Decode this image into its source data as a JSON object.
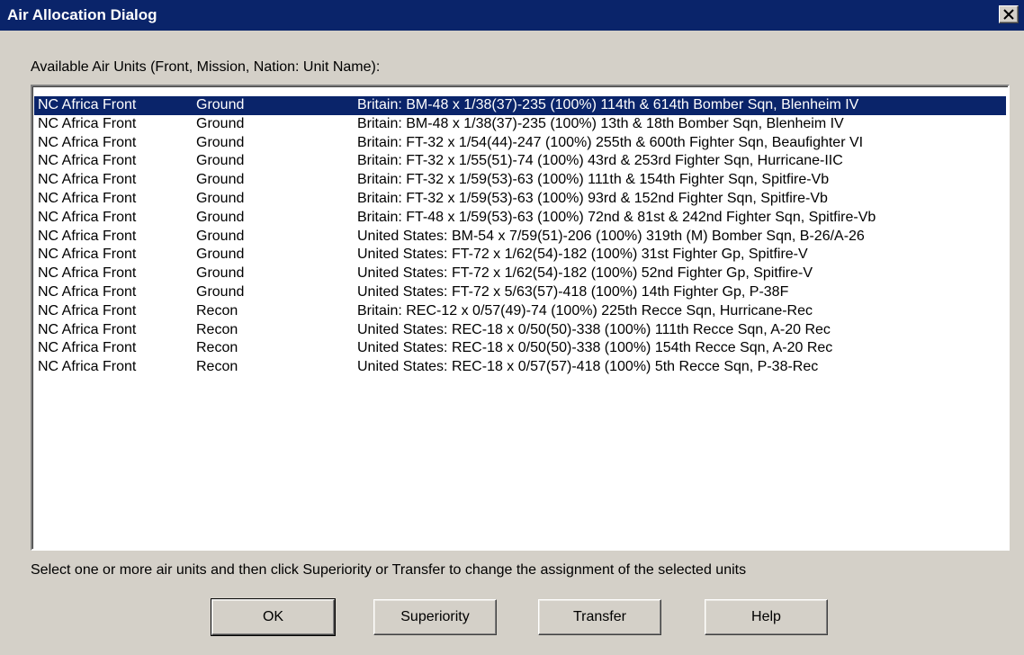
{
  "window": {
    "title": "Air Allocation Dialog"
  },
  "list": {
    "label": "Available Air Units (Front, Mission, Nation: Unit Name):",
    "selected_index": 0,
    "rows": [
      {
        "front": "NC Africa Front",
        "mission": "Ground",
        "unit": "Britain: BM-48 x 1/38(37)-235 (100%) 114th & 614th Bomber Sqn, Blenheim IV"
      },
      {
        "front": "NC Africa Front",
        "mission": "Ground",
        "unit": "Britain: BM-48 x 1/38(37)-235 (100%) 13th & 18th Bomber Sqn, Blenheim IV"
      },
      {
        "front": "NC Africa Front",
        "mission": "Ground",
        "unit": "Britain: FT-32 x 1/54(44)-247 (100%) 255th & 600th Fighter Sqn, Beaufighter VI"
      },
      {
        "front": "NC Africa Front",
        "mission": "Ground",
        "unit": "Britain: FT-32 x 1/55(51)-74 (100%) 43rd & 253rd Fighter Sqn, Hurricane-IIC"
      },
      {
        "front": "NC Africa Front",
        "mission": "Ground",
        "unit": "Britain: FT-32 x 1/59(53)-63 (100%) 111th & 154th Fighter Sqn, Spitfire-Vb"
      },
      {
        "front": "NC Africa Front",
        "mission": "Ground",
        "unit": "Britain: FT-32 x 1/59(53)-63 (100%) 93rd & 152nd Fighter Sqn, Spitfire-Vb"
      },
      {
        "front": "NC Africa Front",
        "mission": "Ground",
        "unit": "Britain: FT-48 x 1/59(53)-63 (100%) 72nd & 81st & 242nd Fighter Sqn, Spitfire-Vb"
      },
      {
        "front": "NC Africa Front",
        "mission": "Ground",
        "unit": "United States: BM-54 x 7/59(51)-206 (100%) 319th (M) Bomber Sqn, B-26/A-26"
      },
      {
        "front": "NC Africa Front",
        "mission": "Ground",
        "unit": "United States: FT-72 x 1/62(54)-182 (100%) 31st Fighter Gp, Spitfire-V"
      },
      {
        "front": "NC Africa Front",
        "mission": "Ground",
        "unit": "United States: FT-72 x 1/62(54)-182 (100%) 52nd Fighter Gp, Spitfire-V"
      },
      {
        "front": "NC Africa Front",
        "mission": "Ground",
        "unit": "United States: FT-72 x 5/63(57)-418 (100%) 14th Fighter Gp, P-38F"
      },
      {
        "front": "NC Africa Front",
        "mission": "Recon",
        "unit": "Britain: REC-12 x 0/57(49)-74 (100%) 225th Recce Sqn, Hurricane-Rec"
      },
      {
        "front": "NC Africa Front",
        "mission": "Recon",
        "unit": "United States: REC-18 x 0/50(50)-338 (100%) 111th Recce Sqn, A-20 Rec"
      },
      {
        "front": "NC Africa Front",
        "mission": "Recon",
        "unit": "United States: REC-18 x 0/50(50)-338 (100%) 154th Recce Sqn, A-20 Rec"
      },
      {
        "front": "NC Africa Front",
        "mission": "Recon",
        "unit": "United States: REC-18 x 0/57(57)-418 (100%) 5th Recce Sqn, P-38-Rec"
      }
    ]
  },
  "hint": "Select one or more air units and then click Superiority or Transfer to change the assignment of the selected units",
  "buttons": {
    "ok": "OK",
    "superiority": "Superiority",
    "transfer": "Transfer",
    "help": "Help"
  },
  "colors": {
    "titlebar": "#0a246a",
    "selection": "#0a246a",
    "face": "#d4d0c8"
  },
  "icons": {
    "close": "close-icon"
  }
}
